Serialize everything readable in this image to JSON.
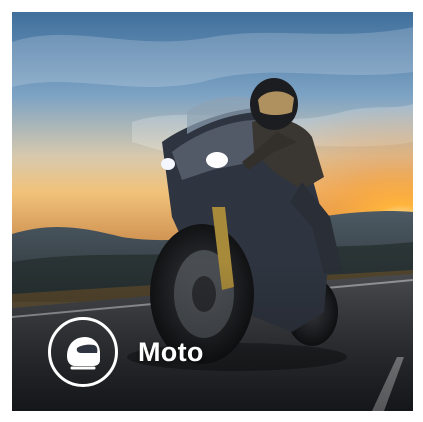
{
  "category": {
    "label": "Moto",
    "icon": "helmet-icon",
    "image": "motorcycle-rider-sunset-photo"
  },
  "colors": {
    "text": "#ffffff",
    "sun": "#ffb43a",
    "sky_top": "#3f6f9c",
    "road": "#2e3136"
  }
}
